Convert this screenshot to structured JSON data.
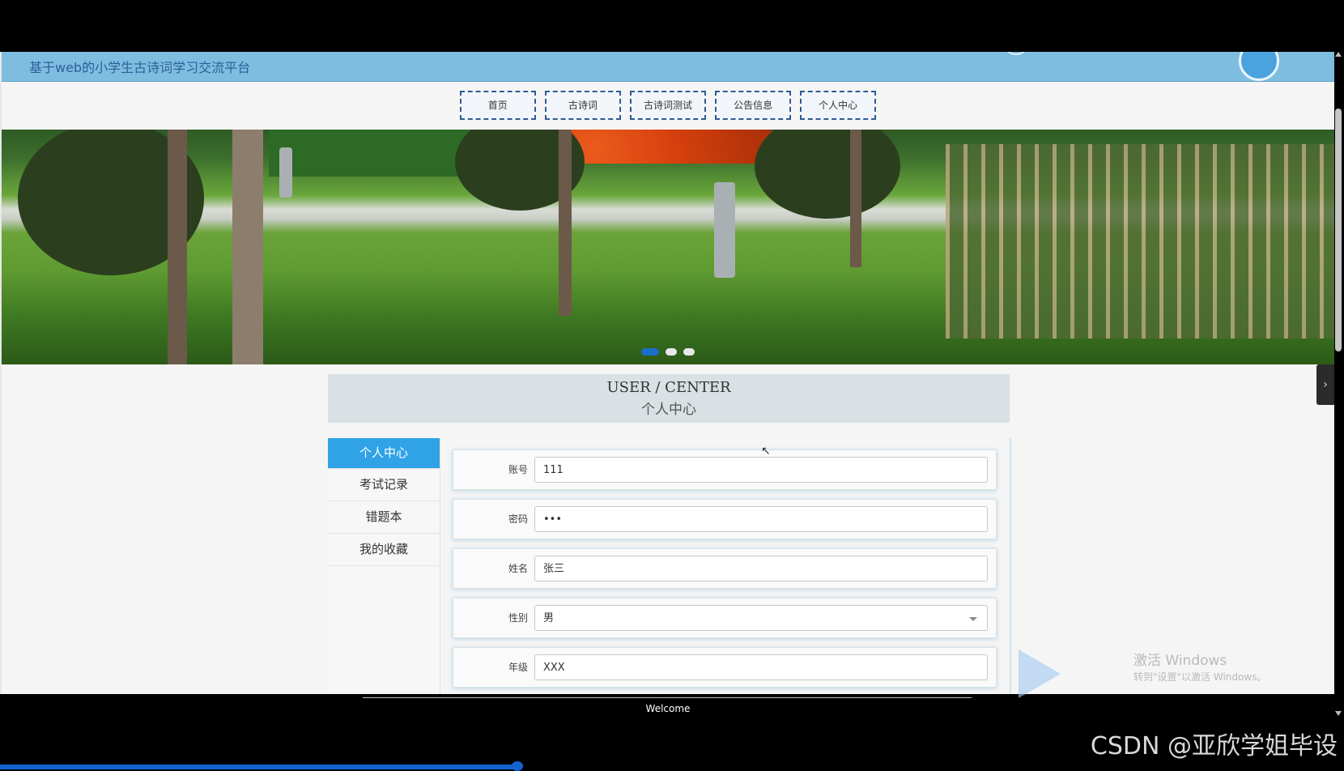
{
  "header": {
    "site_title": "基于web的小学生古诗词学习交流平台"
  },
  "nav": {
    "items": [
      "首页",
      "古诗词",
      "古诗词测试",
      "公告信息",
      "个人中心"
    ]
  },
  "banner": {
    "slide_count": 3,
    "active_slide": 0
  },
  "user_center": {
    "title_en": "USER / CENTER",
    "title_cn": "个人中心"
  },
  "sidebar": {
    "items": [
      "个人中心",
      "考试记录",
      "错题本",
      "我的收藏"
    ],
    "active_index": 0
  },
  "form": {
    "fields": [
      {
        "label": "账号",
        "value": "111"
      },
      {
        "label": "密码",
        "value": "•••"
      },
      {
        "label": "姓名",
        "value": "张三"
      },
      {
        "label": "性别",
        "value": "男"
      },
      {
        "label": "年级",
        "value": "XXX"
      }
    ]
  },
  "footer": {
    "text": "Welcome"
  },
  "overlay": {
    "watermark": "CSDN @亚欣学姐毕设",
    "windows_line1": "激活 Windows",
    "windows_line2": "转到\"设置\"以激活 Windows。"
  },
  "video": {
    "progress_fraction": 0.385
  },
  "colors": {
    "topbar": "#7fbde0",
    "nav_border": "#2f5b93",
    "sidebar_active": "#2fa3e6",
    "progress": "#1463d3"
  }
}
